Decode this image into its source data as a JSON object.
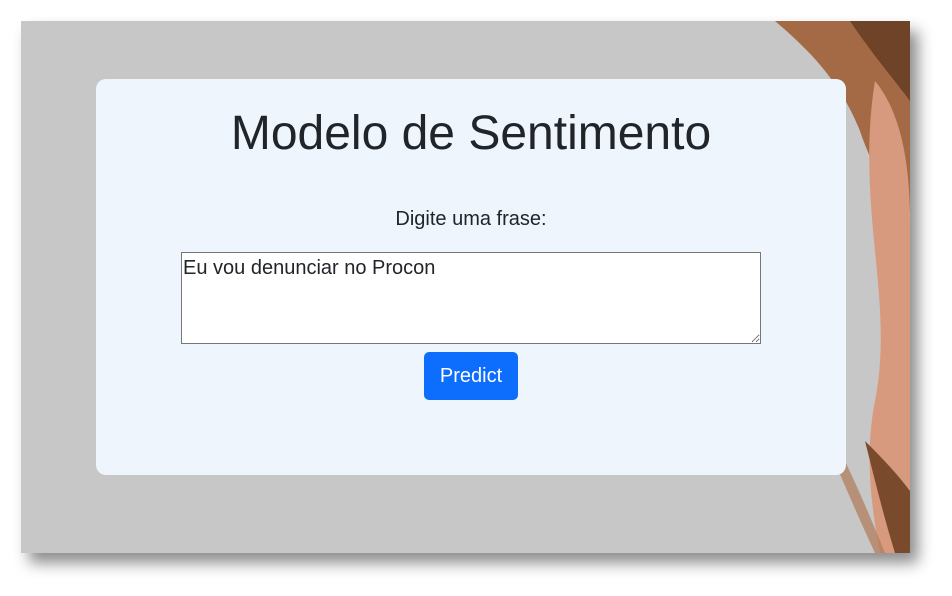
{
  "page": {
    "title": "Modelo de Sentimento",
    "input_label": "Digite uma frase:",
    "input_value": "Eu vou denunciar no Procon",
    "submit_label": "Predict"
  },
  "colors": {
    "background": "#c7c7c7",
    "card": "#eef5fd",
    "button": "#0d6efd",
    "text": "#212529"
  },
  "icons": {
    "background_art": "woman-portrait-image"
  }
}
